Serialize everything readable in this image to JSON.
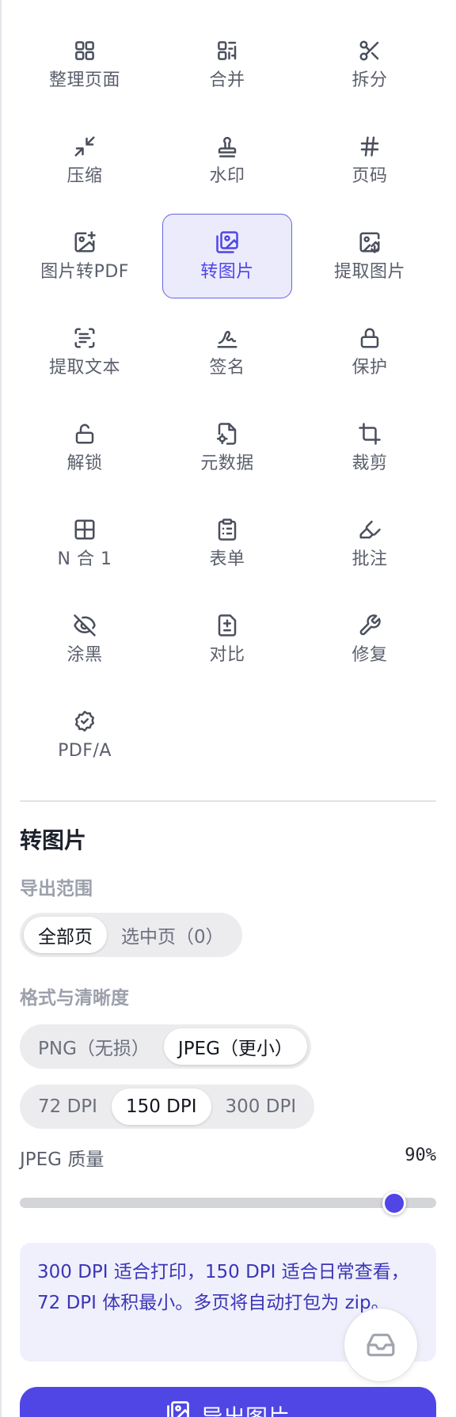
{
  "tools": [
    {
      "label": "整理页面",
      "icon": "grid-icon"
    },
    {
      "label": "合并",
      "icon": "merge-icon"
    },
    {
      "label": "拆分",
      "icon": "scissors-icon"
    },
    {
      "label": "压缩",
      "icon": "compress-icon"
    },
    {
      "label": "水印",
      "icon": "stamp-icon"
    },
    {
      "label": "页码",
      "icon": "hash-icon"
    },
    {
      "label": "图片转PDF",
      "icon": "image-plus-icon"
    },
    {
      "label": "转图片",
      "icon": "images-icon"
    },
    {
      "label": "提取图片",
      "icon": "image-download-icon"
    },
    {
      "label": "提取文本",
      "icon": "scan-text-icon"
    },
    {
      "label": "签名",
      "icon": "signature-icon"
    },
    {
      "label": "保护",
      "icon": "lock-icon"
    },
    {
      "label": "解锁",
      "icon": "unlock-icon"
    },
    {
      "label": "元数据",
      "icon": "file-cog-icon"
    },
    {
      "label": "裁剪",
      "icon": "crop-icon"
    },
    {
      "label": "N 合 1",
      "icon": "layout-grid-icon"
    },
    {
      "label": "表单",
      "icon": "clipboard-list-icon"
    },
    {
      "label": "批注",
      "icon": "pen-annotate-icon"
    },
    {
      "label": "涂黑",
      "icon": "eye-off-icon"
    },
    {
      "label": "对比",
      "icon": "file-diff-icon"
    },
    {
      "label": "修复",
      "icon": "wrench-icon"
    },
    {
      "label": "PDF/A",
      "icon": "badge-check-icon"
    }
  ],
  "active_tool": "转图片",
  "panel": {
    "title": "转图片",
    "range_label": "导出范围",
    "range_options": [
      "全部页",
      "选中页（0）"
    ],
    "range_selected": "全部页",
    "format_label": "格式与清晰度",
    "format_options": [
      "PNG（无损）",
      "JPEG（更小）"
    ],
    "format_selected": "JPEG（更小）",
    "dpi_options": [
      "72 DPI",
      "150 DPI",
      "300 DPI"
    ],
    "dpi_selected": "150 DPI",
    "quality_label": "JPEG 质量",
    "quality_value": "90%",
    "quality_fraction": 0.9,
    "info_text": "300 DPI 适合打印，150 DPI 适合日常查看，72 DPI 体积最小。多页将自动打包为 zip。",
    "export_label": "导出图片"
  },
  "colors": {
    "accent": "#4f46e5",
    "active_bg": "#ebebfc",
    "info_bg": "#eff0fc"
  }
}
